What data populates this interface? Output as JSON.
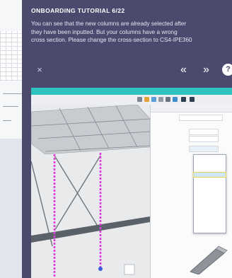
{
  "modal": {
    "title": "ONBOARDING TUTORIAL 6/22",
    "text_lines": [
      "You can see that the new columns are already selected after",
      "they have been inputted. But your columns have a wrong",
      "cross section. Please change the cross-section to CS4-IPE360"
    ],
    "close_glyph": "×",
    "prev_glyph": "«",
    "next_glyph": "»",
    "help_glyph": "?"
  },
  "colors": {
    "modal_bg": "#4b4a6e",
    "accent_teal": "#2fc3c0",
    "column_highlight": "#e23be0",
    "beam": "#5b6168"
  },
  "icons": [
    "close-icon",
    "previous-step-icon",
    "next-step-icon",
    "help-icon"
  ]
}
